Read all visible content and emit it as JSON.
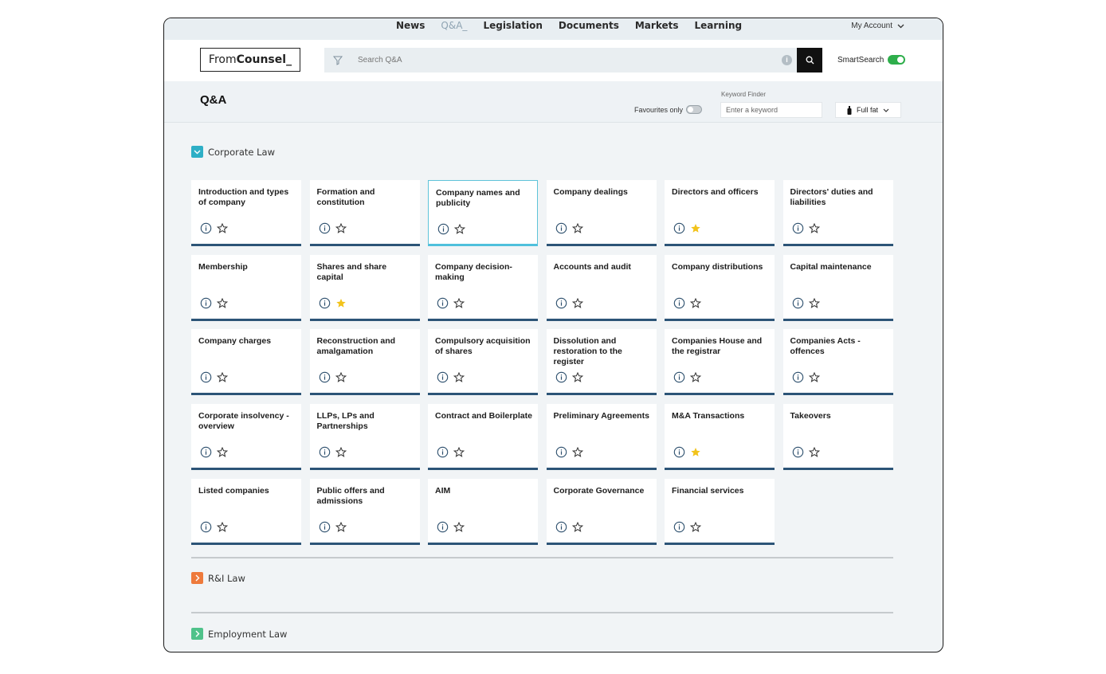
{
  "nav": {
    "items": [
      "News",
      "Q&A_",
      "Legislation",
      "Documents",
      "Markets",
      "Learning"
    ],
    "account_label": "My Account"
  },
  "header": {
    "logo_from": "From",
    "logo_counsel": "Counsel_",
    "search_placeholder": "Search Q&A",
    "smartsearch_label": "SmartSearch"
  },
  "subheader": {
    "title": "Q&A",
    "favourites_label": "Favourites only",
    "keyword_label": "Keyword Finder",
    "keyword_placeholder": "Enter a keyword",
    "fullfat_label": "Full fat"
  },
  "sections": [
    {
      "label": "Corporate Law",
      "color": "#2eafc6",
      "expanded": true
    },
    {
      "label": "R&I Law",
      "color": "#ee7a3c",
      "expanded": false
    },
    {
      "label": "Employment Law",
      "color": "#4fc28a",
      "expanded": false
    }
  ],
  "colors": {
    "card_bar": "#2c5477",
    "selected_bar": "#4fc0dc",
    "star_filled": "#f2c31b",
    "toggle_on": "#2eae4b"
  },
  "cards": [
    {
      "title": "Introduction and types of company",
      "fav": false,
      "selected": false
    },
    {
      "title": "Formation and constitution",
      "fav": false,
      "selected": false
    },
    {
      "title": "Company names and publicity",
      "fav": false,
      "selected": true
    },
    {
      "title": "Company dealings",
      "fav": false,
      "selected": false
    },
    {
      "title": "Directors and officers",
      "fav": true,
      "selected": false
    },
    {
      "title": "Directors' duties and liabilities",
      "fav": false,
      "selected": false
    },
    {
      "title": "Membership",
      "fav": false,
      "selected": false
    },
    {
      "title": "Shares and share capital",
      "fav": true,
      "selected": false
    },
    {
      "title": "Company decision-making",
      "fav": false,
      "selected": false
    },
    {
      "title": "Accounts and audit",
      "fav": false,
      "selected": false
    },
    {
      "title": "Company distributions",
      "fav": false,
      "selected": false
    },
    {
      "title": "Capital maintenance",
      "fav": false,
      "selected": false
    },
    {
      "title": "Company charges",
      "fav": false,
      "selected": false
    },
    {
      "title": "Reconstruction and amalgamation",
      "fav": false,
      "selected": false
    },
    {
      "title": "Compulsory acquisition of shares",
      "fav": false,
      "selected": false
    },
    {
      "title": "Dissolution and restoration to the register",
      "fav": false,
      "selected": false
    },
    {
      "title": "Companies House and the registrar",
      "fav": false,
      "selected": false
    },
    {
      "title": "Companies Acts - offences",
      "fav": false,
      "selected": false
    },
    {
      "title": "Corporate insolvency - overview",
      "fav": false,
      "selected": false
    },
    {
      "title": "LLPs, LPs and Partnerships",
      "fav": false,
      "selected": false
    },
    {
      "title": "Contract and Boilerplate",
      "fav": false,
      "selected": false
    },
    {
      "title": "Preliminary Agreements",
      "fav": false,
      "selected": false
    },
    {
      "title": "M&A Transactions",
      "fav": true,
      "selected": false
    },
    {
      "title": "Takeovers",
      "fav": false,
      "selected": false
    },
    {
      "title": "Listed companies",
      "fav": false,
      "selected": false
    },
    {
      "title": "Public offers and admissions",
      "fav": false,
      "selected": false
    },
    {
      "title": "AIM",
      "fav": false,
      "selected": false
    },
    {
      "title": "Corporate Governance",
      "fav": false,
      "selected": false
    },
    {
      "title": "Financial services",
      "fav": false,
      "selected": false
    }
  ]
}
